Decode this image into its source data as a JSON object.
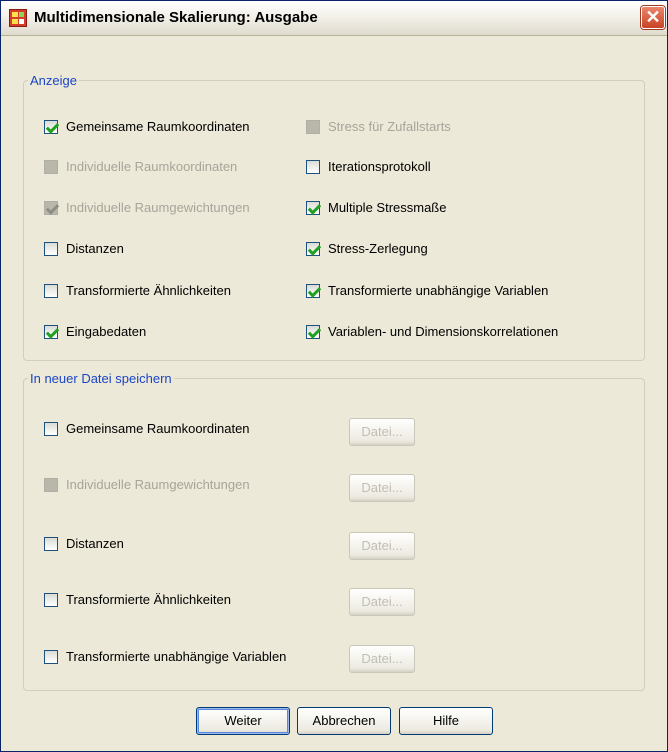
{
  "window": {
    "title": "Multidimensionale Skalierung: Ausgabe",
    "close_label": "✕"
  },
  "display": {
    "legend": "Anzeige",
    "left": [
      {
        "label": "Gemeinsame Raumkoordinaten",
        "checked": true,
        "enabled": true
      },
      {
        "label": "Individuelle Raumkoordinaten",
        "checked": false,
        "enabled": false
      },
      {
        "label": "Individuelle Raumgewichtungen",
        "checked": true,
        "enabled": false
      },
      {
        "label": "Distanzen",
        "checked": false,
        "enabled": true
      },
      {
        "label": "Transformierte Ähnlichkeiten",
        "checked": false,
        "enabled": true
      },
      {
        "label": "Eingabedaten",
        "checked": true,
        "enabled": true
      }
    ],
    "right": [
      {
        "label": "Stress für Zufallstarts",
        "checked": false,
        "enabled": false
      },
      {
        "label": "Iterationsprotokoll",
        "checked": false,
        "enabled": true
      },
      {
        "label": "Multiple Stressmaße",
        "checked": true,
        "enabled": true
      },
      {
        "label": "Stress-Zerlegung",
        "checked": true,
        "enabled": true
      },
      {
        "label": "Transformierte unabhängige Variablen",
        "checked": true,
        "enabled": true
      },
      {
        "label": "Variablen- und Dimensionskorrelationen",
        "checked": true,
        "enabled": true
      }
    ]
  },
  "save": {
    "legend": "In neuer Datei speichern",
    "items": [
      {
        "label": "Gemeinsame Raumkoordinaten",
        "checked": false,
        "enabled": true,
        "button": "Datei..."
      },
      {
        "label": "Individuelle Raumgewichtungen",
        "checked": false,
        "enabled": false,
        "button": "Datei..."
      },
      {
        "label": "Distanzen",
        "checked": false,
        "enabled": true,
        "button": "Datei..."
      },
      {
        "label": "Transformierte Ähnlichkeiten",
        "checked": false,
        "enabled": true,
        "button": "Datei..."
      },
      {
        "label": "Transformierte unabhängige Variablen",
        "checked": false,
        "enabled": true,
        "button": "Datei..."
      }
    ]
  },
  "buttons": {
    "continue": "Weiter",
    "cancel": "Abbrechen",
    "help": "Hilfe"
  }
}
